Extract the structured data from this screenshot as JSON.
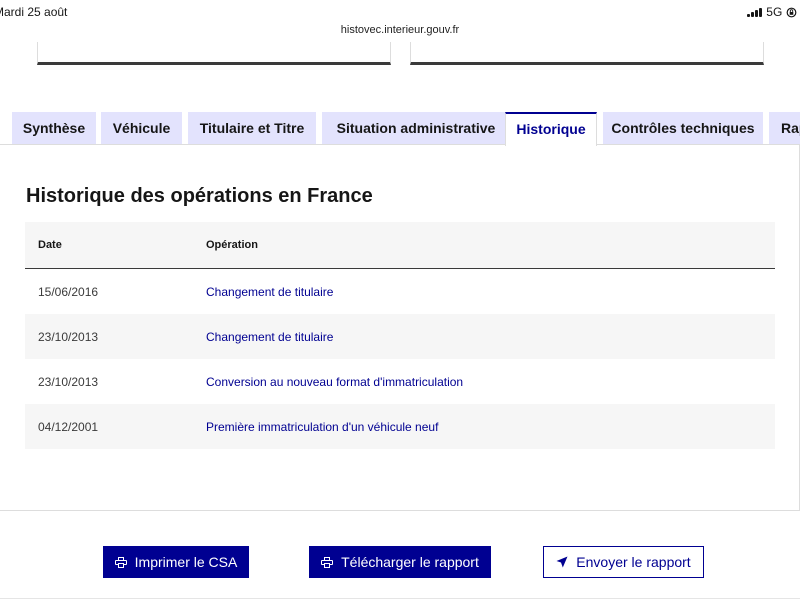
{
  "status_bar": {
    "time": "Mardi 25 août",
    "network": "5G",
    "battery": "9"
  },
  "browser": {
    "url": "histovec.interieur.gouv.fr"
  },
  "tabs": [
    {
      "label": "Synthèse",
      "active": false
    },
    {
      "label": "Véhicule",
      "active": false
    },
    {
      "label": "Titulaire et Titre",
      "active": false
    },
    {
      "label": "Situation administrative",
      "active": false
    },
    {
      "label": "Historique",
      "active": true
    },
    {
      "label": "Contrôles techniques",
      "active": false
    },
    {
      "label": "Rap",
      "active": false
    }
  ],
  "section": {
    "title": "Historique des opérations en France"
  },
  "table": {
    "headers": {
      "date": "Date",
      "operation": "Opération"
    },
    "rows": [
      {
        "date": "15/06/2016",
        "operation": "Changement de titulaire"
      },
      {
        "date": "23/10/2013",
        "operation": "Changement de titulaire"
      },
      {
        "date": "23/10/2013",
        "operation": "Conversion au nouveau format d'immatriculation"
      },
      {
        "date": "04/12/2001",
        "operation": "Première immatriculation d'un véhicule neuf"
      }
    ]
  },
  "actions": {
    "print_csa": "Imprimer le CSA",
    "download_report": "Télécharger le rapport",
    "send_report": "Envoyer le rapport"
  },
  "colors": {
    "primary": "#000091",
    "tab_background": "#e3e3fd",
    "row_alt": "#f6f6f6"
  },
  "icons": {
    "print": "printer-icon",
    "send": "send-icon"
  }
}
